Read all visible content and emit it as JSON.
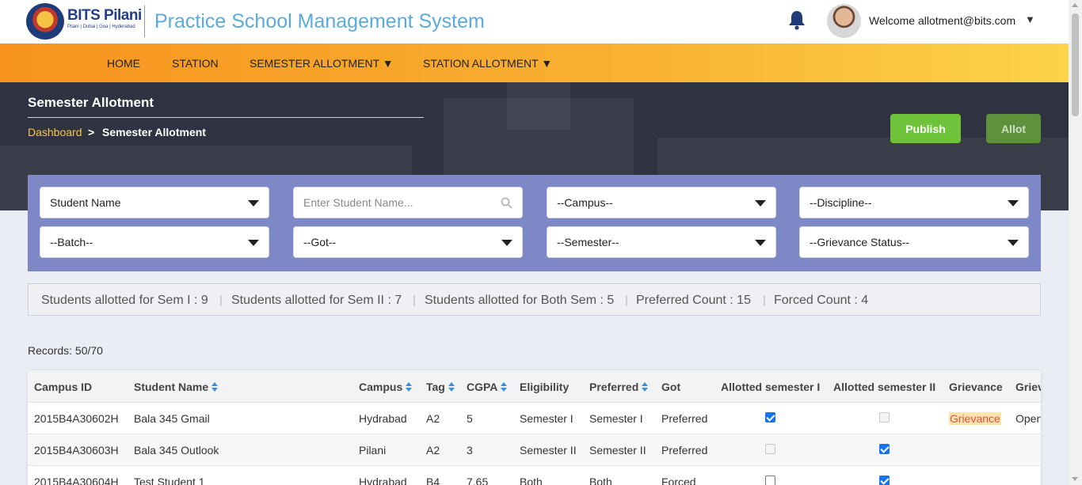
{
  "header": {
    "logo_text": "BITS Pilani",
    "logo_sub": "Pilani | Dubai | Goa | Hyderabad",
    "app_title": "Practice School Management System",
    "welcome": "Welcome allotment@bits.com",
    "caret": "▼"
  },
  "nav": {
    "items": [
      "HOME",
      "STATION",
      "SEMESTER ALLOTMENT ▼",
      "STATION ALLOTMENT ▼"
    ]
  },
  "hero": {
    "title": "Semester Allotment",
    "breadcrumb_link": "Dashboard",
    "breadcrumb_sep": ">",
    "breadcrumb_current": "Semester Allotment",
    "publish_label": "Publish",
    "allot_label": "Allot"
  },
  "filters": {
    "search_by": "Student Name",
    "search_placeholder": "Enter Student Name...",
    "campus": "--Campus--",
    "discipline": "--Discipline--",
    "batch": "--Batch--",
    "got": "--Got--",
    "semester": "--Semester--",
    "grievance_status": "--Grievance Status--"
  },
  "summary": {
    "sem1": "Students allotted for Sem I : 9",
    "sem2": "Students allotted for Sem II : 7",
    "both": "Students allotted for Both Sem : 5",
    "preferred": "Preferred Count : 15",
    "forced": "Forced Count : 4",
    "sep": "|"
  },
  "records": "Records: 50/70",
  "table": {
    "headers": [
      "Campus ID",
      "Student Name",
      "Campus",
      "Tag",
      "CGPA",
      "Eligibility",
      "Preferred",
      "Got",
      "Allotted semester I",
      "Allotted semester II",
      "Grievance",
      "Grievance Status"
    ],
    "rows": [
      {
        "campus_id": "2015B4A30602H",
        "name": "Bala 345 Gmail",
        "campus": "Hydrabad",
        "tag": "A2",
        "cgpa": "5",
        "eligibility": "Semester I",
        "preferred": "Semester I",
        "got": "Preferred",
        "sem1": "checked",
        "sem2": "disabled",
        "grievance": "Grievance",
        "status": "Open"
      },
      {
        "campus_id": "2015B4A30603H",
        "name": "Bala 345 Outlook",
        "campus": "Pilani",
        "tag": "A2",
        "cgpa": "3",
        "eligibility": "Semester II",
        "preferred": "Semester II",
        "got": "Preferred",
        "sem1": "disabled",
        "sem2": "checked",
        "grievance": "",
        "status": ""
      },
      {
        "campus_id": "2015B4A30604H",
        "name": "Test Student 1",
        "campus": "Hydrabad",
        "tag": "B4",
        "cgpa": "7.65",
        "eligibility": "Both",
        "preferred": "Both",
        "got": "Forced",
        "sem1": "unchecked",
        "sem2": "checked",
        "grievance": "",
        "status": ""
      }
    ]
  },
  "colors": {
    "accent_blue": "#5aabd9",
    "nav_orange": "#f7931e",
    "publish_green": "#6fc33b",
    "filter_panel": "#7e88c6"
  }
}
